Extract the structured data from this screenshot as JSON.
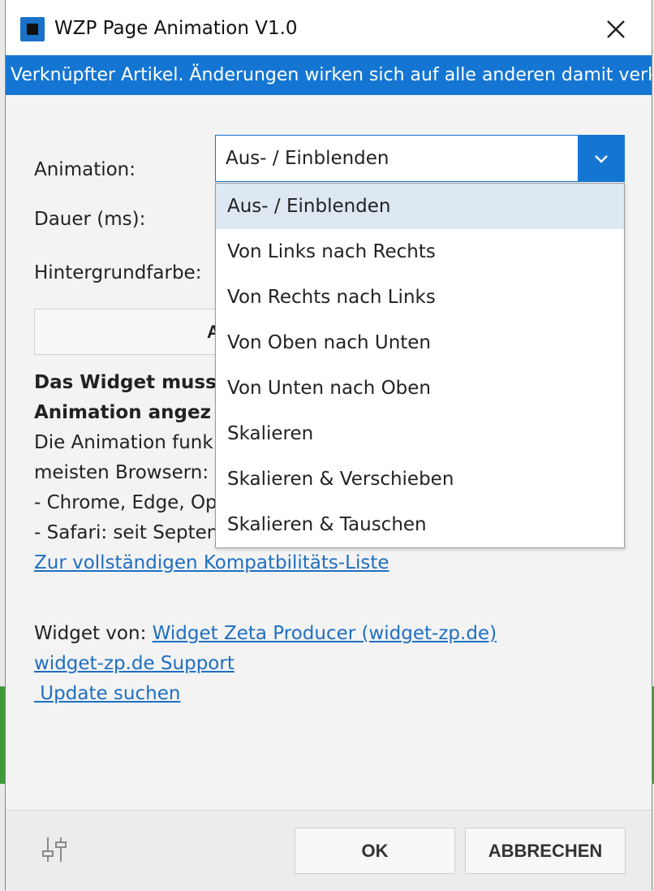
{
  "window": {
    "title": "WZP Page Animation V1.0",
    "banner": "Verknüpfter Artikel. Änderungen wirken sich auf alle anderen damit verk…"
  },
  "form": {
    "animation_label": "Animation:",
    "duration_label": "Dauer (ms):",
    "bgcolor_label": "Hintergrundfarbe:",
    "animation_selected": "Aus- / Einblenden",
    "animation_options": [
      "Aus- / Einblenden",
      "Von Links nach Rechts",
      "Von Rechts nach Links",
      "Von Oben nach Unten",
      "Von Unten nach Oben",
      "Skalieren",
      "Skalieren & Verschieben",
      "Skalieren & Tauschen"
    ],
    "button_partial": "A"
  },
  "info": {
    "bold_line1": "Das Widget muss",
    "bold_line2": "Animation angez",
    "line3": "Die Animation funk",
    "line4": "meisten Browsern:",
    "line5": "- Chrome, Edge, Op",
    "line6": "- Safari: seit Septen",
    "compat_link": "Zur vollständigen Kompatbilitäts-Liste",
    "widget_by_label": "Widget von: ",
    "widget_by_link": "Widget Zeta Producer (widget-zp.de)",
    "support_link": "widget-zp.de Support",
    "update_link": " Update suchen"
  },
  "footer": {
    "ok": "OK",
    "cancel": "ABBRECHEN"
  },
  "colors": {
    "accent": "#1476d2",
    "selected_option_bg": "#dde8f2",
    "link": "#1f6fc1"
  }
}
